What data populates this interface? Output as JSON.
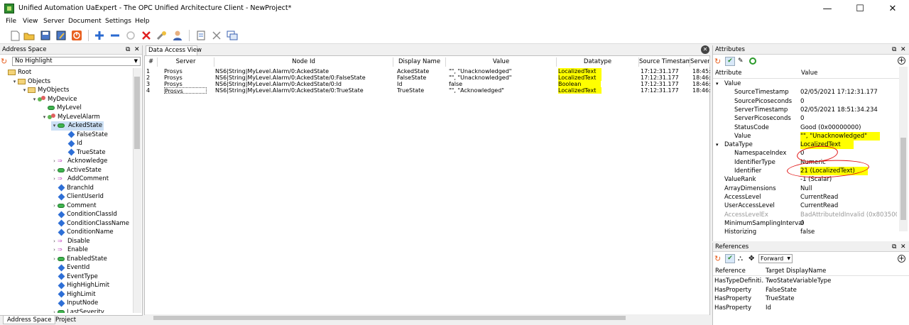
{
  "window": {
    "title": "Unified Automation UaExpert - The OPC Unified Architecture Client - NewProject*",
    "minimize": "—",
    "maximize": "☐",
    "close": "✕"
  },
  "menu": [
    "File",
    "View",
    "Server",
    "Document",
    "Settings",
    "Help"
  ],
  "toolbar": {
    "icons": [
      "new-file-icon",
      "open-folder-icon",
      "save-icon",
      "save-as-icon",
      "power-icon",
      "add-server-icon",
      "remove-server-icon",
      "connect-icon",
      "disconnect-icon",
      "settings-wrench-icon",
      "user-icon",
      "document-icon",
      "cut-icon",
      "window-icon"
    ]
  },
  "address_space": {
    "title": "Address Space",
    "highlight": "No Highlight",
    "tree": [
      {
        "label": "Root",
        "depth": 0,
        "icon": "folder",
        "exp": "",
        "selected": false
      },
      {
        "label": "Objects",
        "depth": 1,
        "icon": "folder",
        "exp": "▾"
      },
      {
        "label": "MyObjects",
        "depth": 2,
        "icon": "folder",
        "exp": "▾"
      },
      {
        "label": "MyDevice",
        "depth": 3,
        "icon": "object",
        "exp": "▾"
      },
      {
        "label": "MyLevel",
        "depth": 4,
        "icon": "var",
        "exp": ""
      },
      {
        "label": "MyLevelAlarm",
        "depth": 4,
        "icon": "object",
        "exp": "▾"
      },
      {
        "label": "AckedState",
        "depth": 5,
        "icon": "var",
        "exp": "▾",
        "selected": true
      },
      {
        "label": "FalseState",
        "depth": 6,
        "icon": "prop",
        "exp": ""
      },
      {
        "label": "Id",
        "depth": 6,
        "icon": "prop",
        "exp": ""
      },
      {
        "label": "TrueState",
        "depth": 6,
        "icon": "prop",
        "exp": ""
      },
      {
        "label": "Acknowledge",
        "depth": 5,
        "icon": "method",
        "exp": "›"
      },
      {
        "label": "ActiveState",
        "depth": 5,
        "icon": "var",
        "exp": "›"
      },
      {
        "label": "AddComment",
        "depth": 5,
        "icon": "method",
        "exp": "›"
      },
      {
        "label": "BranchId",
        "depth": 5,
        "icon": "prop",
        "exp": ""
      },
      {
        "label": "ClientUserId",
        "depth": 5,
        "icon": "prop",
        "exp": ""
      },
      {
        "label": "Comment",
        "depth": 5,
        "icon": "var",
        "exp": "›"
      },
      {
        "label": "ConditionClassId",
        "depth": 5,
        "icon": "prop",
        "exp": ""
      },
      {
        "label": "ConditionClassName",
        "depth": 5,
        "icon": "prop",
        "exp": ""
      },
      {
        "label": "ConditionName",
        "depth": 5,
        "icon": "prop",
        "exp": ""
      },
      {
        "label": "Disable",
        "depth": 5,
        "icon": "method",
        "exp": "›"
      },
      {
        "label": "Enable",
        "depth": 5,
        "icon": "method",
        "exp": "›"
      },
      {
        "label": "EnabledState",
        "depth": 5,
        "icon": "var",
        "exp": "›"
      },
      {
        "label": "EventId",
        "depth": 5,
        "icon": "prop",
        "exp": ""
      },
      {
        "label": "EventType",
        "depth": 5,
        "icon": "prop",
        "exp": ""
      },
      {
        "label": "HighHighLimit",
        "depth": 5,
        "icon": "prop",
        "exp": ""
      },
      {
        "label": "HighLimit",
        "depth": 5,
        "icon": "prop",
        "exp": ""
      },
      {
        "label": "InputNode",
        "depth": 5,
        "icon": "prop",
        "exp": ""
      },
      {
        "label": "LastSeverity",
        "depth": 5,
        "icon": "var",
        "exp": "›"
      }
    ],
    "tabs": [
      "Address Space",
      "Project"
    ]
  },
  "data_access": {
    "tab": "Data Access View",
    "columns": [
      "#",
      "Server",
      "Node Id",
      "Display Name",
      "Value",
      "Datatype",
      "Source Timestamp",
      "Server"
    ],
    "rows": [
      {
        "n": "1",
        "server": "Prosys",
        "nodeid": "NS6|String|MyLevel.Alarm/0:AckedState",
        "name": "AckedState",
        "value": "\"\", \"Unacknowledged\"",
        "datatype": "LocalizedText",
        "src_ts": "17:12:31.177",
        "srv_ts": "18:45:"
      },
      {
        "n": "2",
        "server": "Prosys",
        "nodeid": "NS6|String|MyLevel.Alarm/0:AckedState/0:FalseState",
        "name": "FalseState",
        "value": "\"\", \"Unacknowledged\"",
        "datatype": "LocalizedText",
        "src_ts": "17:12:31.177",
        "srv_ts": "18:46:"
      },
      {
        "n": "3",
        "server": "Prosys",
        "nodeid": "NS6|String|MyLevel.Alarm/0:AckedState/0:Id",
        "name": "Id",
        "value": "false",
        "datatype": "Boolean",
        "src_ts": "17:12:31.177",
        "srv_ts": "18:46:"
      },
      {
        "n": "4",
        "server": "Prosys",
        "nodeid": "NS6|String|MyLevel.Alarm/0:AckedState/0:TrueState",
        "name": "TrueState",
        "value": "\"\", \"Acknowledged\"",
        "datatype": "LocalizedText",
        "src_ts": "17:12:31.177",
        "srv_ts": "18:46:"
      }
    ]
  },
  "attributes": {
    "title": "Attributes",
    "col_attr": "Attribute",
    "col_value": "Value",
    "rows": [
      {
        "name": "Value",
        "value": "",
        "indent": 0,
        "exp": "▾"
      },
      {
        "name": "SourceTimestamp",
        "value": "02/05/2021 17:12:31.177",
        "indent": 2
      },
      {
        "name": "SourcePicoseconds",
        "value": "0",
        "indent": 2
      },
      {
        "name": "ServerTimestamp",
        "value": "02/05/2021 18:51:34.234",
        "indent": 2
      },
      {
        "name": "ServerPicoseconds",
        "value": "0",
        "indent": 2
      },
      {
        "name": "StatusCode",
        "value": "Good (0x00000000)",
        "indent": 2
      },
      {
        "name": "Value",
        "value": "\"\", \"Unacknowledged\"",
        "indent": 2,
        "hl": true
      },
      {
        "name": "DataType",
        "value": "LocalizedText",
        "indent": 0,
        "exp": "▾",
        "hl": true
      },
      {
        "name": "NamespaceIndex",
        "value": "0",
        "indent": 2
      },
      {
        "name": "IdentifierType",
        "value": "Numeric",
        "indent": 2
      },
      {
        "name": "Identifier",
        "value": "21 (LocalizedText)",
        "indent": 2,
        "hl": true
      },
      {
        "name": "ValueRank",
        "value": "-1 (Scalar)",
        "indent": 1
      },
      {
        "name": "ArrayDimensions",
        "value": "Null",
        "indent": 1
      },
      {
        "name": "AccessLevel",
        "value": "CurrentRead",
        "indent": 1
      },
      {
        "name": "UserAccessLevel",
        "value": "CurrentRead",
        "indent": 1
      },
      {
        "name": "AccessLevelEx",
        "value": "BadAttributeIdInvalid (0x80350000)",
        "indent": 1,
        "grey": true
      },
      {
        "name": "MinimumSamplingInterval",
        "value": "0",
        "indent": 1
      },
      {
        "name": "Historizing",
        "value": "false",
        "indent": 1
      }
    ]
  },
  "references": {
    "title": "References",
    "direction": "Forward",
    "col_ref": "Reference",
    "col_target": "Target DisplayName",
    "rows": [
      {
        "ref": "HasTypeDefiniti...",
        "target": "TwoStateVariableType"
      },
      {
        "ref": "HasProperty",
        "target": "FalseState"
      },
      {
        "ref": "HasProperty",
        "target": "TrueState"
      },
      {
        "ref": "HasProperty",
        "target": "Id"
      }
    ]
  },
  "colors": {
    "highlight": "#ffff00",
    "annotation": "#e01010",
    "selection": "#cce0f5"
  }
}
